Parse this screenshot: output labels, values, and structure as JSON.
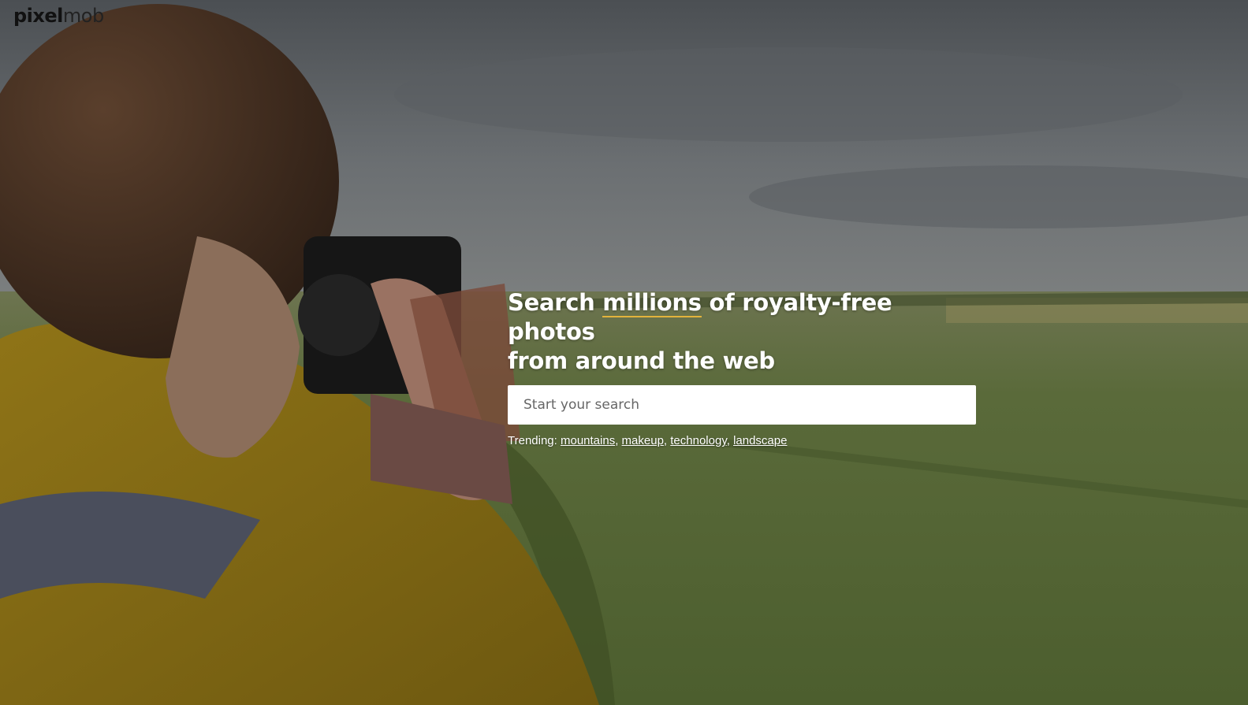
{
  "logo": {
    "part1": "pixel",
    "part2": "mob"
  },
  "hero": {
    "headline_prefix": "Search",
    "headline_highlight": "millions",
    "headline_suffix_line1": "of royalty-free photos",
    "headline_line2": "from around the web",
    "search_placeholder": "Start your search",
    "search_value": "",
    "trending_label": "Trending:",
    "trending_terms": [
      "mountains",
      "makeup",
      "technology",
      "landscape"
    ],
    "highlight_color": "#e2b33c"
  },
  "icons": [
    "camera-illustration"
  ]
}
